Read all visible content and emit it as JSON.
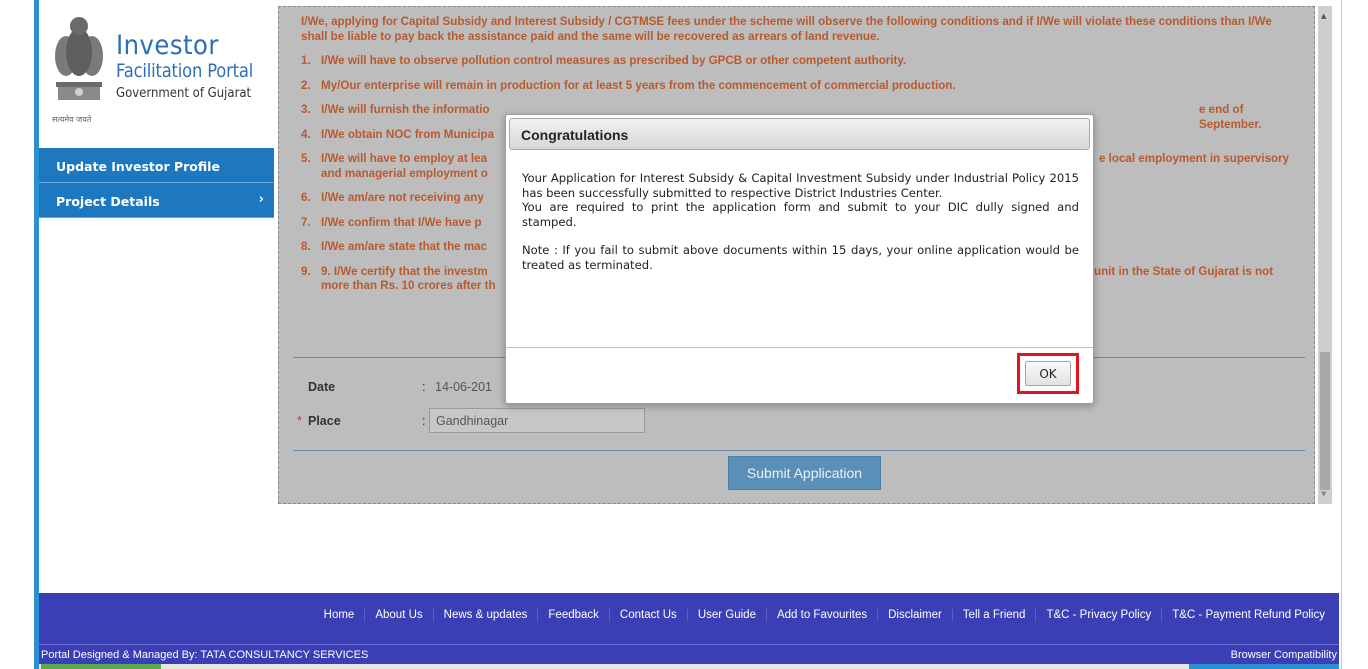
{
  "logo": {
    "line1": "Investor",
    "line2": "Facilitation Portal",
    "line3": "Government of Gujarat",
    "motto": "सत्यमेव जयते"
  },
  "sidebar": {
    "items": [
      {
        "label": "Update Investor Profile"
      },
      {
        "label": "Project Details",
        "chevron": "›"
      }
    ]
  },
  "terms": {
    "intro": "I/We, applying for Capital Subsidy and Interest Subsidy / CGTMSE fees under the scheme will observe the following conditions and if I/We will violate these conditions than I/We shall be liable to pay back the assistance paid and the same will be recovered as arrears of land revenue.",
    "items": [
      {
        "num": "1.",
        "text": "I/We will have to observe pollution control measures as prescribed by GPCB or other competent authority."
      },
      {
        "num": "2.",
        "text": "My/Our enterprise will remain in production for at least 5 years from the commencement of commercial production."
      },
      {
        "num": "3.",
        "text": "I/We will furnish the informatio",
        "tail": "e end of September."
      },
      {
        "num": "4.",
        "text": "I/We obtain NOC from Municipa"
      },
      {
        "num": "5.",
        "text": "I/We will have to employ at lea",
        "tail": "e local employment in supervisory",
        "line2": "and managerial employment o"
      },
      {
        "num": "6.",
        "text": "I/We am/are not receiving any"
      },
      {
        "num": "7.",
        "text": "I/We confirm that I/We have p"
      },
      {
        "num": "8.",
        "text": "I/We am/are state that the mac"
      },
      {
        "num": "9.",
        "text": "9. I/We certify that the investm",
        "tail": "unit in the State of Gujarat is not",
        "line2": "more than Rs. 10 crores after th"
      }
    ]
  },
  "form": {
    "date_label": "Date",
    "date_value": "14-06-201",
    "place_label": "Place",
    "place_value": "Gandhinagar",
    "colon": ":",
    "required_mark": "*"
  },
  "submit_label": "Submit Application",
  "modal": {
    "title": "Congratulations",
    "para1": "Your Application for Interest Subsidy & Capital Investment Subsidy under Industrial Policy 2015 has been successfully submitted to respective District Industries Center.",
    "para2": "You are required to print the application form and submit to your DIC dully signed and stamped.",
    "para3": "Note : If you fail to submit above documents within 15 days, your online application would be treated as terminated.",
    "ok_label": "OK"
  },
  "footer": {
    "links": [
      "Home",
      "About Us",
      "News & updates",
      "Feedback",
      "Contact Us",
      "User Guide",
      "Add to Favourites",
      "Disclaimer",
      "Tell a Friend",
      "T&C - Privacy Policy",
      "T&C - Payment Refund Policy"
    ],
    "credit": "Portal Designed & Managed By: TATA CONSULTANCY SERVICES",
    "compat": "Browser Compatibility"
  },
  "colors": {
    "accent": "#2b8fd6",
    "sidebar": "#1e78c0",
    "footer": "#3b3fb6",
    "term_text": "#b85a2e",
    "highlight": "#e0141e"
  }
}
